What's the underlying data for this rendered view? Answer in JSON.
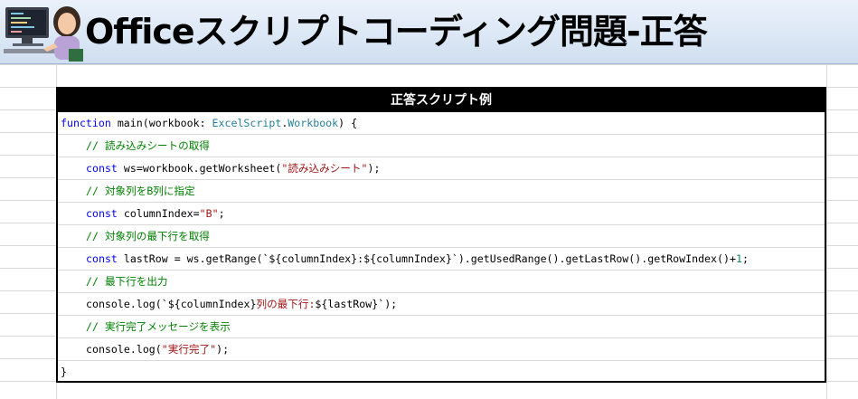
{
  "header": {
    "title": "Officeスクリプトコーディング問題-正答"
  },
  "panel": {
    "title": "正答スクリプト例"
  },
  "code": {
    "l1_kw": "function",
    "l1_a": " main(workbook: ",
    "l1_ty1": "ExcelScript",
    "l1_dot": ".",
    "l1_ty2": "Workbook",
    "l1_b": ") {",
    "l2_cm": "// 読み込みシートの取得",
    "l3_kw": "const",
    "l3_a": " ws=workbook.getWorksheet(",
    "l3_st": "\"読み込みシート\"",
    "l3_b": ");",
    "l4_cm": "// 対象列をB列に指定",
    "l5_kw": "const",
    "l5_a": " columnIndex=",
    "l5_st": "\"B\"",
    "l5_b": ";",
    "l6_cm": "// 対象列の最下行を取得",
    "l7_kw": "const",
    "l7_a": " lastRow = ws.getRange(`${columnIndex}:${columnIndex}`).getUsedRange().getLastRow().getRowIndex()+",
    "l7_nm": "1",
    "l7_b": ";",
    "l8_cm": "// 最下行を出力",
    "l9_a": "console.log(`${columnIndex}",
    "l9_st": "列の最下行:",
    "l9_b": "${lastRow}`);",
    "l10_cm": "// 実行完了メッセージを表示",
    "l11_a": "console.log(",
    "l11_st": "\"実行完了\"",
    "l11_b": ");",
    "l12": "}"
  },
  "illustration": {
    "icon": "person-at-computer-illustration"
  },
  "colors": {
    "keyword": "#0000ff",
    "type": "#267f99",
    "comment": "#008000",
    "string": "#a31515",
    "number": "#098658",
    "header_bg": "#000000"
  }
}
